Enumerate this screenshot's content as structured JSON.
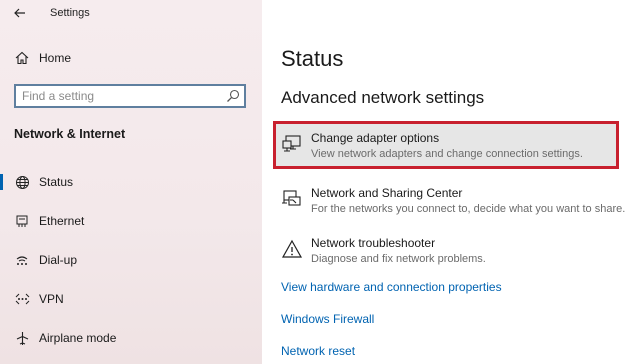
{
  "window": {
    "title": "Settings"
  },
  "sidebar": {
    "home_label": "Home",
    "search_placeholder": "Find a setting",
    "section_heading": "Network & Internet",
    "items": [
      {
        "label": "Status",
        "icon": "globe-icon",
        "selected": true
      },
      {
        "label": "Ethernet",
        "icon": "ethernet-icon",
        "selected": false
      },
      {
        "label": "Dial-up",
        "icon": "dial-up-icon",
        "selected": false
      },
      {
        "label": "VPN",
        "icon": "vpn-icon",
        "selected": false
      },
      {
        "label": "Airplane mode",
        "icon": "airplane-icon",
        "selected": false
      }
    ]
  },
  "main": {
    "page_title": "Status",
    "section_title": "Advanced network settings",
    "options": [
      {
        "title": "Change adapter options",
        "description": "View network adapters and change connection settings.",
        "icon": "adapter-icon",
        "highlighted": true
      },
      {
        "title": "Network and Sharing Center",
        "description": "For the networks you connect to, decide what you want to share.",
        "icon": "sharing-center-icon",
        "highlighted": false
      },
      {
        "title": "Network troubleshooter",
        "description": "Diagnose and fix network problems.",
        "icon": "warning-icon",
        "highlighted": false
      }
    ],
    "links": [
      "View hardware and connection properties",
      "Windows Firewall",
      "Network reset"
    ]
  },
  "colors": {
    "accent": "#0063b1",
    "highlight_border": "#c8202e",
    "highlight_bg": "#e6e6e6"
  }
}
